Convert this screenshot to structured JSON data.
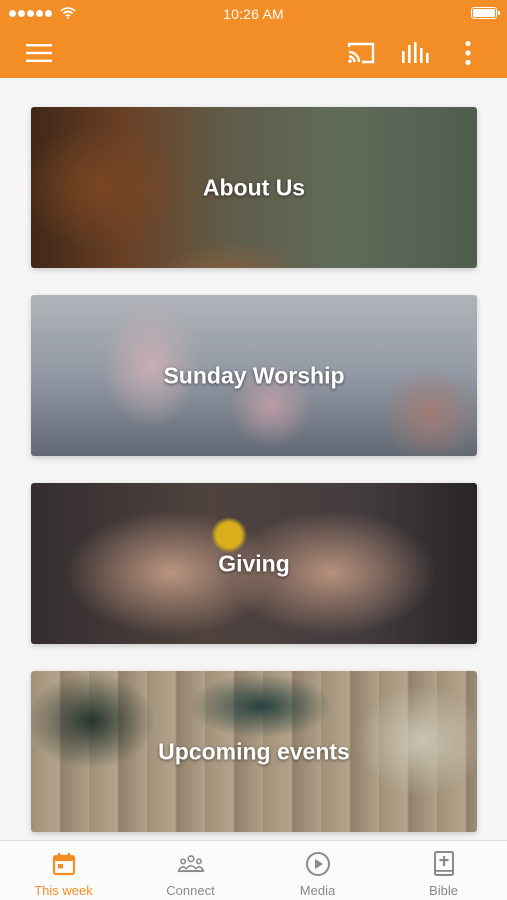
{
  "status_bar": {
    "time": "10:26 AM"
  },
  "app_bar": {
    "icons": [
      "hamburger-menu-icon",
      "cast-icon",
      "audio-bars-icon",
      "more-vert-icon"
    ]
  },
  "cards": [
    {
      "title": "About Us"
    },
    {
      "title": "Sunday Worship"
    },
    {
      "title": "Giving"
    },
    {
      "title": "Upcoming events"
    }
  ],
  "bottom_nav": {
    "tabs": [
      {
        "label": "This week",
        "icon": "calendar-icon",
        "active": true
      },
      {
        "label": "Connect",
        "icon": "people-icon",
        "active": false
      },
      {
        "label": "Media",
        "icon": "play-circle-icon",
        "active": false
      },
      {
        "label": "Bible",
        "icon": "bible-icon",
        "active": false
      }
    ]
  },
  "colors": {
    "primary": "#f28e25",
    "inactive": "#8a8a8a"
  }
}
